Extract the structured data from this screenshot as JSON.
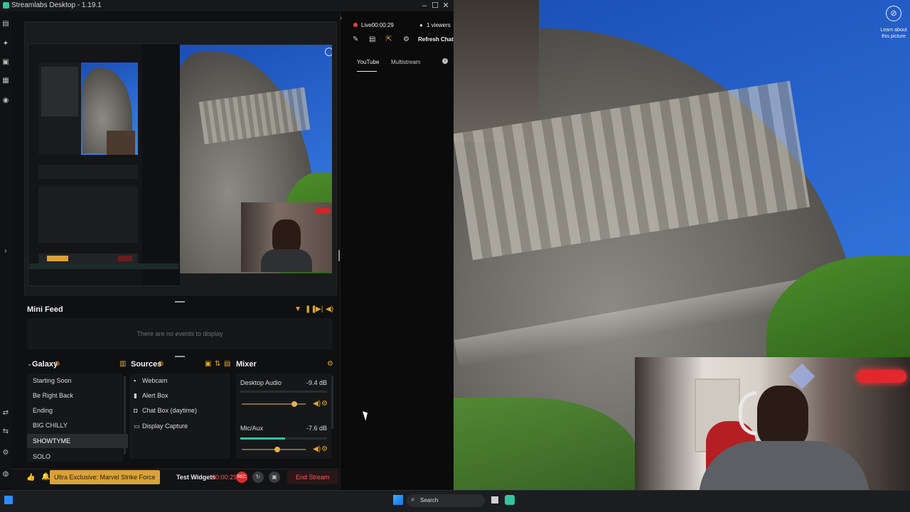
{
  "window": {
    "title": "Streamlabs Desktop - 1.19.1"
  },
  "chat": {
    "live_label": "Live",
    "live_time": "00:00:29",
    "viewers": "1 viewers",
    "refresh_label": "Refresh Chat",
    "tabs": [
      "YouTube",
      "Multistream"
    ]
  },
  "preview": {
    "overlay_caption": "Learn about this picture"
  },
  "minifeed": {
    "title": "Mini Feed",
    "empty": "There are no events to display"
  },
  "scenes": {
    "collection": "Galaxy",
    "items": [
      "Starting Soon",
      "Be Right Back",
      "Ending",
      "BIG CHILLY",
      "SHOWTYME",
      "SOLO"
    ],
    "active_index": 4
  },
  "sources": {
    "title": "Sources",
    "items": [
      {
        "icon": "webcam-icon",
        "label": "Webcam"
      },
      {
        "icon": "alert-box-icon",
        "label": "Alert Box"
      },
      {
        "icon": "chat-box-icon",
        "label": "Chat Box (daytime)"
      },
      {
        "icon": "display-capture-icon",
        "label": "Display Capture"
      }
    ]
  },
  "mixer": {
    "title": "Mixer",
    "channels": [
      {
        "name": "Desktop Audio",
        "db": "-9.4 dB",
        "level": 0.0,
        "volume": 0.82
      },
      {
        "name": "Mic/Aux",
        "db": "-7.6 dB",
        "level": 0.52,
        "volume": 0.55
      }
    ]
  },
  "bottombar": {
    "promo": "Ultra Exclusive: Marvel Strike Force",
    "test_widgets": "Test Widgets",
    "rec_time": "00:00:29",
    "rec_badge": "REC",
    "end_stream": "End Stream"
  },
  "bigphoto": {
    "caption": "Learn about this picture"
  },
  "taskbar": {
    "search_placeholder": "Search"
  },
  "colors": {
    "accent": "#31c3a2",
    "warning": "#d9a23a",
    "danger": "#ff5b5b"
  }
}
